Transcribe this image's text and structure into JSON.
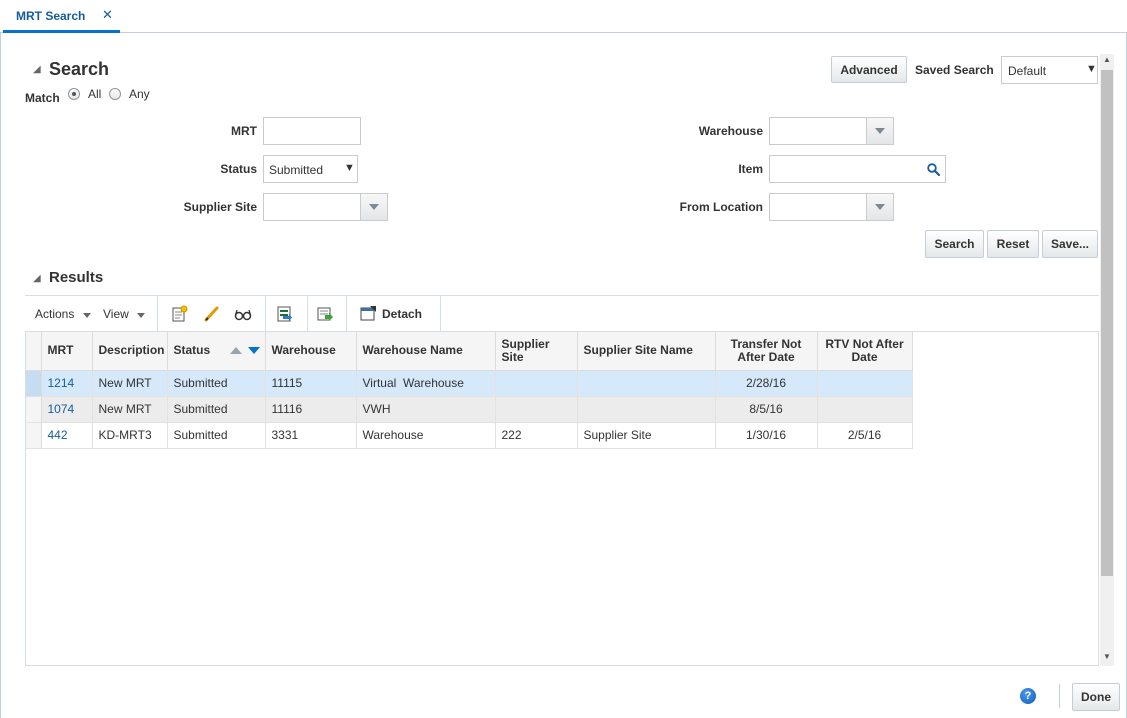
{
  "tab": {
    "label": "MRT Search",
    "close": "✕"
  },
  "search": {
    "title": "Search",
    "advanced_label": "Advanced",
    "saved_search_label": "Saved Search",
    "saved_search_value": "Default",
    "match_label": "Match",
    "match_all": "All",
    "match_any": "Any",
    "fields": {
      "mrt_label": "MRT",
      "mrt_value": "",
      "status_label": "Status",
      "status_value": "Submitted",
      "supplier_site_label": "Supplier Site",
      "supplier_site_value": "",
      "warehouse_label": "Warehouse",
      "warehouse_value": "",
      "item_label": "Item",
      "item_value": "",
      "from_location_label": "From Location",
      "from_location_value": ""
    },
    "buttons": {
      "search": "Search",
      "reset": "Reset",
      "save": "Save..."
    }
  },
  "results": {
    "title": "Results",
    "toolbar": {
      "actions": "Actions",
      "view": "View",
      "detach": "Detach"
    },
    "columns": [
      "MRT",
      "Description",
      "Status",
      "Warehouse",
      "Warehouse Name",
      "Supplier Site",
      "Supplier Site Name",
      "Transfer Not After Date",
      "RTV Not After Date"
    ],
    "rows": [
      {
        "mrt": "1214",
        "description": "New MRT",
        "status": "Submitted",
        "warehouse": "11115",
        "warehouse_name": "Virtual  Warehouse",
        "supplier_site": "",
        "supplier_site_name": "",
        "transfer_date": "2/28/16",
        "rtv_date": ""
      },
      {
        "mrt": "1074",
        "description": "New MRT",
        "status": "Submitted",
        "warehouse": "11116",
        "warehouse_name": "VWH",
        "supplier_site": "",
        "supplier_site_name": "",
        "transfer_date": "8/5/16",
        "rtv_date": ""
      },
      {
        "mrt": "442",
        "description": "KD-MRT3",
        "status": "Submitted",
        "warehouse": "3331",
        "warehouse_name": "Warehouse",
        "supplier_site": "222",
        "supplier_site_name": "Supplier Site",
        "transfer_date": "1/30/16",
        "rtv_date": "2/5/16"
      }
    ]
  },
  "footer": {
    "help": "?",
    "done": "Done"
  }
}
